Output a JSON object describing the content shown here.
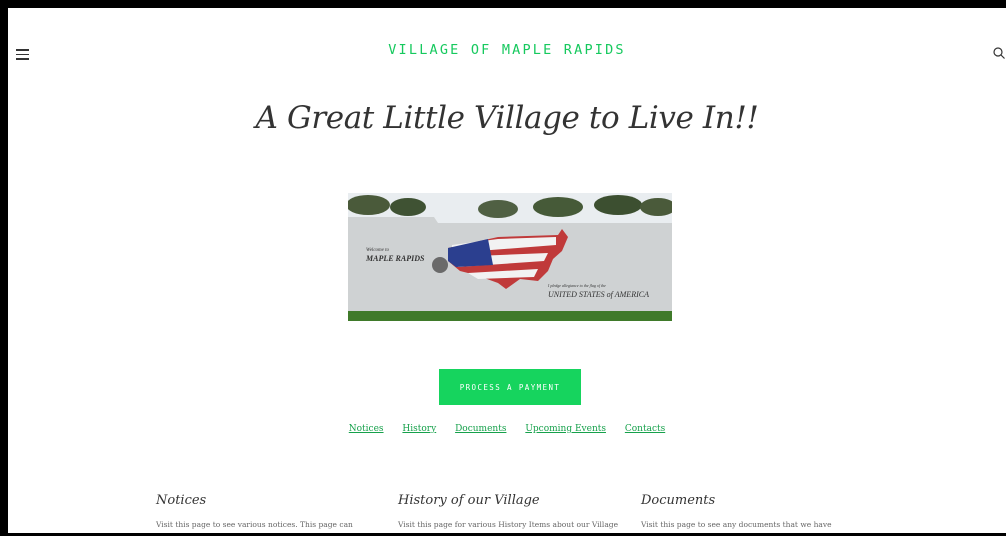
{
  "header": {
    "menu_icon": "hamburger-menu-icon",
    "site_title": "VILLAGE OF MAPLE RAPIDS",
    "search_icon": "search-icon"
  },
  "hero": {
    "tagline": "A Great Little Village to Live In!!",
    "mural": {
      "welcome_line": "Welcome to",
      "town_name": "MAPLE RAPIDS",
      "pledge_line": "I pledge allegiance to the flag of the",
      "country": "UNITED STATES of AMERICA"
    }
  },
  "cta": {
    "label": "PROCESS A PAYMENT"
  },
  "quick_links": [
    "Notices",
    "History",
    "Documents",
    "Upcoming Events",
    "Contacts"
  ],
  "sections": [
    {
      "title": "Notices",
      "text": "Visit this page to see various notices.  This page can"
    },
    {
      "title": "History of our Village",
      "text": "Visit this page for various History Items about our Village"
    },
    {
      "title": "Documents",
      "text": "Visit this page to see any documents that we have"
    }
  ],
  "colors": {
    "accent": "#16c95e",
    "button": "#16d45e",
    "link": "#16a14b"
  }
}
